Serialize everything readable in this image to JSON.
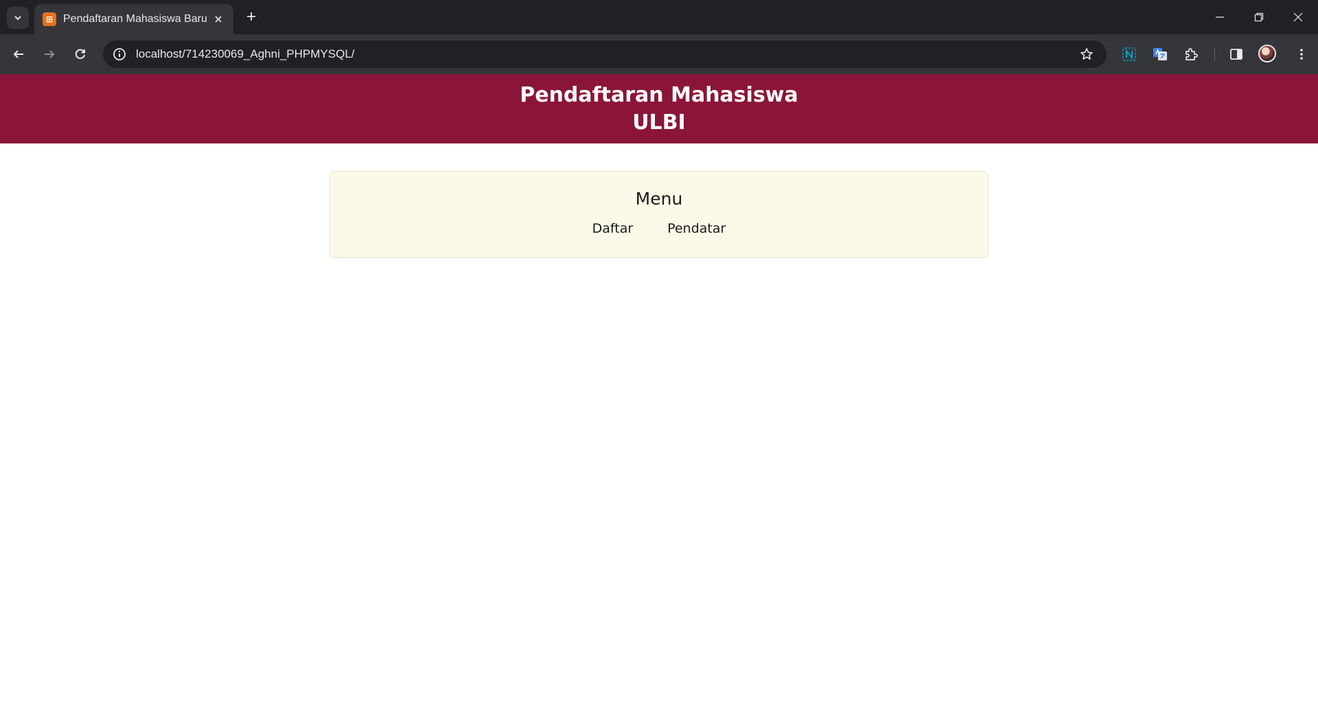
{
  "browser": {
    "tab_title": "Pendaftaran Mahasiswa Baru",
    "favicon_glyph": "⊞",
    "url": "localhost/714230069_Aghni_PHPMYSQL/",
    "icons": {
      "tab_search": "chevron-down-icon",
      "close": "close-icon",
      "new_tab": "plus-icon",
      "back": "arrow-left-icon",
      "forward": "arrow-right-icon",
      "reload": "reload-icon",
      "site_info": "info-icon",
      "bookmark": "star-icon",
      "extensions": "puzzle-icon",
      "side_panel": "side-panel-icon",
      "minimize": "minimize-icon",
      "restore": "restore-icon",
      "window_close": "close-icon"
    }
  },
  "header": {
    "title_line1": "Pendaftaran Mahasiswa",
    "title_line2": "ULBI"
  },
  "menu": {
    "title": "Menu",
    "links": [
      {
        "label": "Daftar"
      },
      {
        "label": "Pendatar"
      }
    ]
  },
  "colors": {
    "header_bg": "#8b1538",
    "menu_bg": "#fdf9e9"
  }
}
